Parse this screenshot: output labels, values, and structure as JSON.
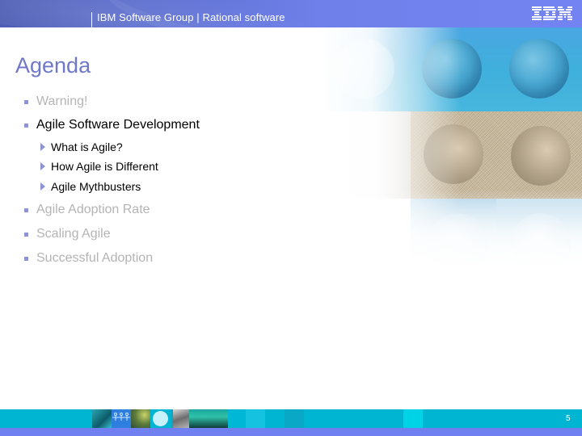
{
  "header": {
    "title": "IBM Software Group | Rational software",
    "logo_text": "IBM",
    "band_color": "#6f80ea"
  },
  "slide": {
    "title": "Agenda",
    "title_color": "#6f78c8",
    "accent_color": "#8c94d6",
    "agenda": [
      {
        "label": "Warning!",
        "state": "dimmed",
        "bullet": "square-bullet-icon"
      },
      {
        "label": "Agile Software Development",
        "state": "active",
        "bullet": "square-bullet-icon",
        "subitems": [
          {
            "label": "What is Agile?",
            "bullet": "arrow-right-icon"
          },
          {
            "label": "How Agile is Different",
            "bullet": "arrow-right-icon"
          },
          {
            "label": "Agile Mythbusters",
            "bullet": "arrow-right-icon"
          }
        ]
      },
      {
        "label": "Agile Adoption Rate",
        "state": "dimmed",
        "bullet": "square-bullet-icon"
      },
      {
        "label": "Scaling Agile",
        "state": "dimmed",
        "bullet": "square-bullet-icon"
      },
      {
        "label": "Successful Adoption",
        "state": "dimmed",
        "bullet": "square-bullet-icon"
      }
    ]
  },
  "footer": {
    "page_number": "5",
    "band_color": "#00b5d2",
    "base_color": "#7080f0",
    "images": [
      "people-image-icon",
      "stick-figures-icon",
      "spiral-image-icon",
      "circle-icon",
      "portrait-image-icon",
      "silhouettes-image-icon"
    ]
  }
}
